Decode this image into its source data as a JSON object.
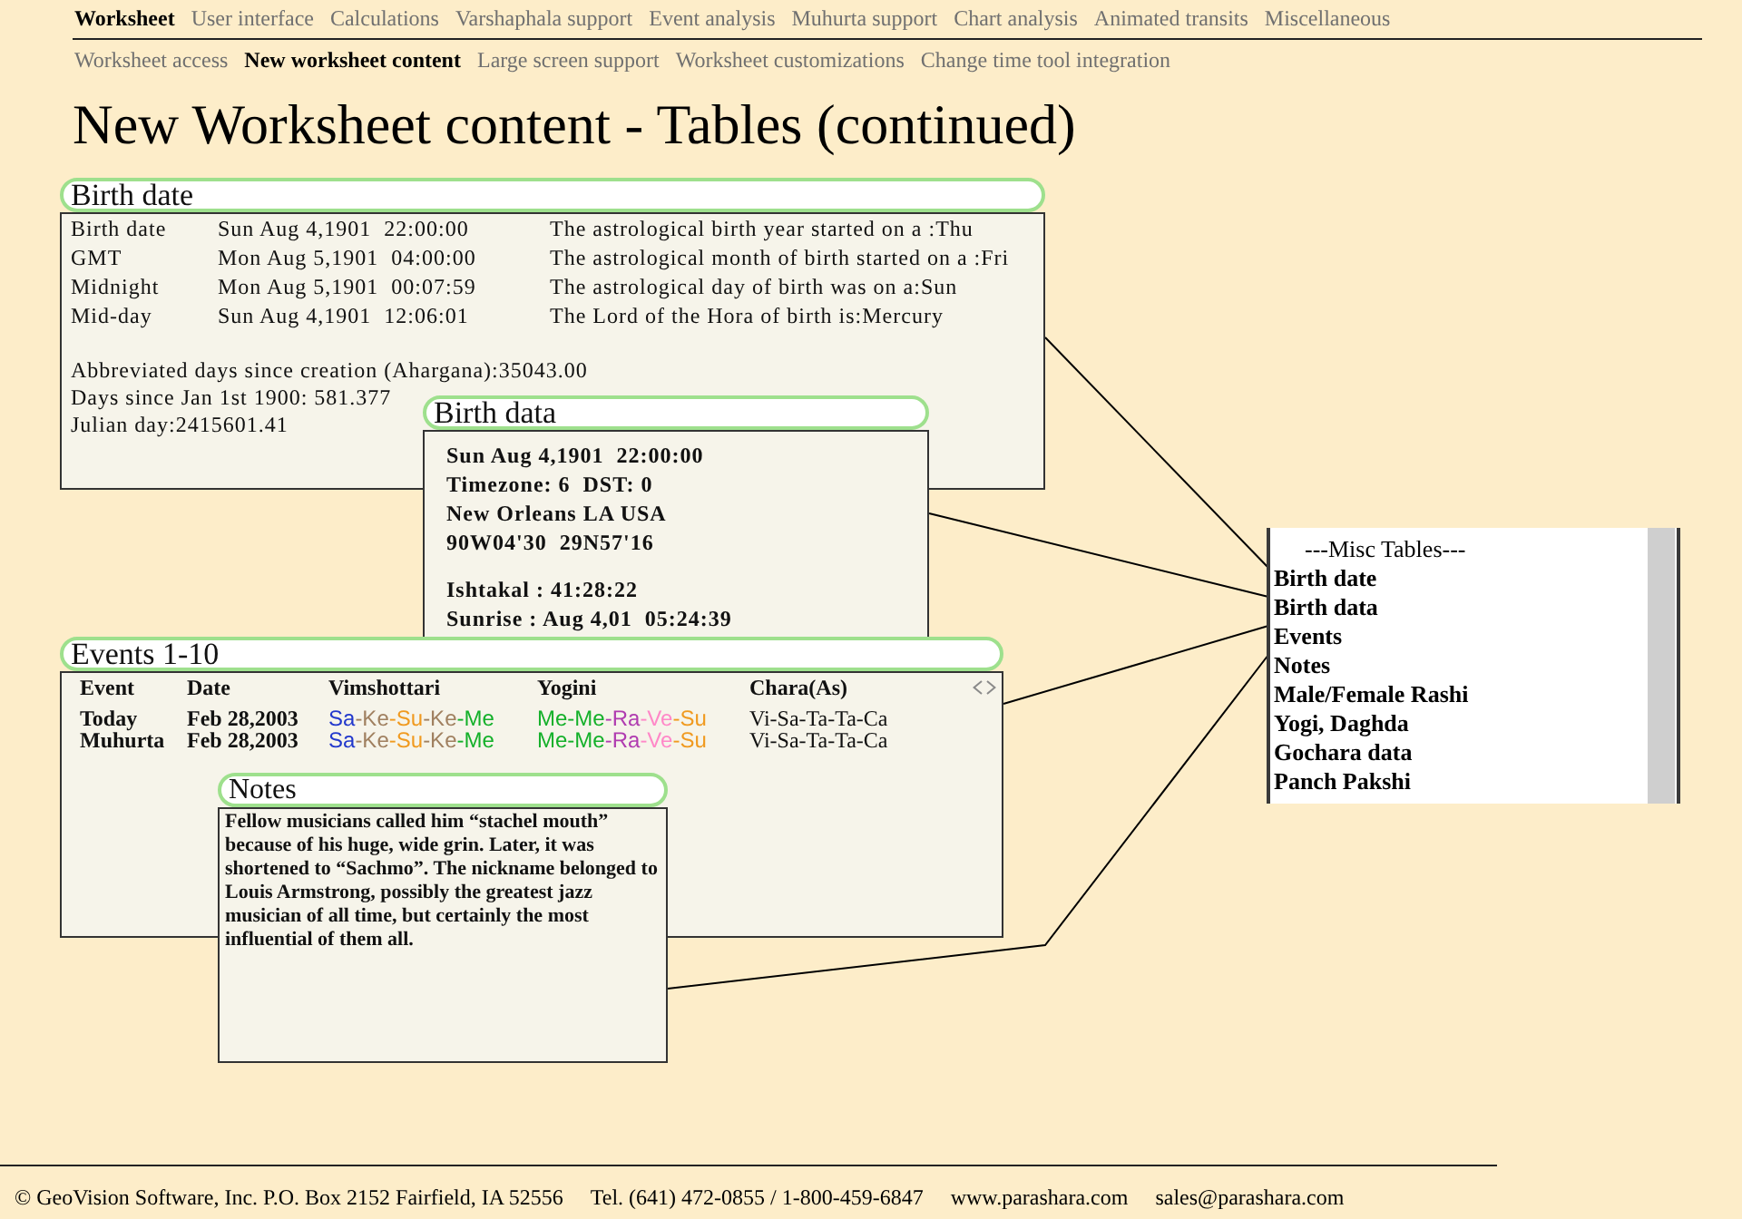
{
  "nav_primary": [
    {
      "label": "Worksheet",
      "selected": true
    },
    {
      "label": "User interface",
      "selected": false
    },
    {
      "label": "Calculations",
      "selected": false
    },
    {
      "label": "Varshaphala support",
      "selected": false
    },
    {
      "label": "Event analysis",
      "selected": false
    },
    {
      "label": "Muhurta support",
      "selected": false
    },
    {
      "label": "Chart analysis",
      "selected": false
    },
    {
      "label": "Animated transits",
      "selected": false
    },
    {
      "label": "Miscellaneous",
      "selected": false
    }
  ],
  "nav_secondary": [
    {
      "label": "Worksheet access",
      "selected": false
    },
    {
      "label": "New worksheet content",
      "selected": true
    },
    {
      "label": "Large screen support",
      "selected": false
    },
    {
      "label": "Worksheet customizations",
      "selected": false
    },
    {
      "label": "Change time tool integration",
      "selected": false
    }
  ],
  "title": "New Worksheet content - Tables (continued)",
  "birth_date_panel": {
    "title": "Birth date",
    "rows": [
      {
        "label": "Birth date",
        "date": "Sun Aug 4,1901  22:00:00",
        "note": "The astrological birth year started on a :Thu"
      },
      {
        "label": "GMT",
        "date": "Mon Aug 5,1901  04:00:00",
        "note": "The astrological month of birth started on a :Fri"
      },
      {
        "label": "Midnight",
        "date": "Mon Aug 5,1901  00:07:59",
        "note": "The astrological day of birth was on a:Sun"
      },
      {
        "label": "Mid-day",
        "date": "Sun Aug 4,1901  12:06:01",
        "note": "The Lord of the Hora of birth is:Mercury"
      }
    ],
    "summary": [
      "Abbreviated days since creation (Ahargana):35043.00",
      "Days since Jan 1st 1900: 581.377",
      "Julian day:2415601.41"
    ]
  },
  "birth_data_panel": {
    "title": "Birth data",
    "groups": [
      {
        "lines": [
          "Sun Aug 4,1901  22:00:00",
          "Timezone: 6  DST: 0",
          "New Orleans LA USA",
          "90W04'30  29N57'16"
        ]
      },
      {
        "lines": [
          "Ishtakal : 41:28:22",
          "Sunrise : Aug 4,01  05:24:39"
        ]
      }
    ]
  },
  "events_panel": {
    "title": "Events 1-10",
    "columns": [
      "Event",
      "Date",
      "Vimshottari",
      "Yogini",
      "Chara(As)"
    ],
    "rows": [
      {
        "event": "Today",
        "date": "Feb 28,2003",
        "vimshottari": [
          {
            "text": "Sa",
            "color": "#2238cc"
          },
          {
            "text": "-Ke",
            "color": "#a08060"
          },
          {
            "text": "-Su",
            "color": "#f09a20"
          },
          {
            "text": "-Ke",
            "color": "#a08060"
          },
          {
            "text": "-Me",
            "color": "#14b02a"
          }
        ],
        "yogini": [
          {
            "text": "Me",
            "color": "#14b02a"
          },
          {
            "text": "-Me",
            "color": "#14b02a"
          },
          {
            "text": "-Ra",
            "color": "#b03cb0"
          },
          {
            "text": "-Ve",
            "color": "#ff88c8"
          },
          {
            "text": "-Su",
            "color": "#f09a20"
          }
        ],
        "chara": "Vi-Sa-Ta-Ta-Ca"
      },
      {
        "event": "Muhurta",
        "date": "Feb 28,2003",
        "vimshottari": [
          {
            "text": "Sa",
            "color": "#2238cc"
          },
          {
            "text": "-Ke",
            "color": "#a08060"
          },
          {
            "text": "-Su",
            "color": "#f09a20"
          },
          {
            "text": "-Ke",
            "color": "#a08060"
          },
          {
            "text": "-Me",
            "color": "#14b02a"
          }
        ],
        "yogini": [
          {
            "text": "Me",
            "color": "#14b02a"
          },
          {
            "text": "-Me",
            "color": "#14b02a"
          },
          {
            "text": "-Ra",
            "color": "#b03cb0"
          },
          {
            "text": "-Ve",
            "color": "#ff88c8"
          },
          {
            "text": "-Su",
            "color": "#f09a20"
          }
        ],
        "chara": "Vi-Sa-Ta-Ta-Ca"
      }
    ]
  },
  "notes_panel": {
    "title": "Notes",
    "text": "Fellow musicians called him “stachel mouth” because of his huge, wide grin. Later, it was shortened to “Sachmo”. The nickname belonged to Louis Armstrong, possibly the greatest jazz musician of all time, but certainly the most influential of them all."
  },
  "misc_tables": {
    "heading": "---Misc Tables---",
    "items": [
      "Birth date",
      "Birth data",
      "Events",
      "Notes",
      "Male/Female Rashi",
      "Yogi, Daghda",
      "Gochara data",
      "Panch Pakshi"
    ]
  },
  "footer": {
    "address": "© GeoVision Software, Inc. P.O. Box 2152 Fairfield, IA 52556",
    "phone": "Tel. (641) 472-0855 / 1-800-459-6847",
    "website": "www.parashara.com",
    "email": "sales@parashara.com"
  }
}
